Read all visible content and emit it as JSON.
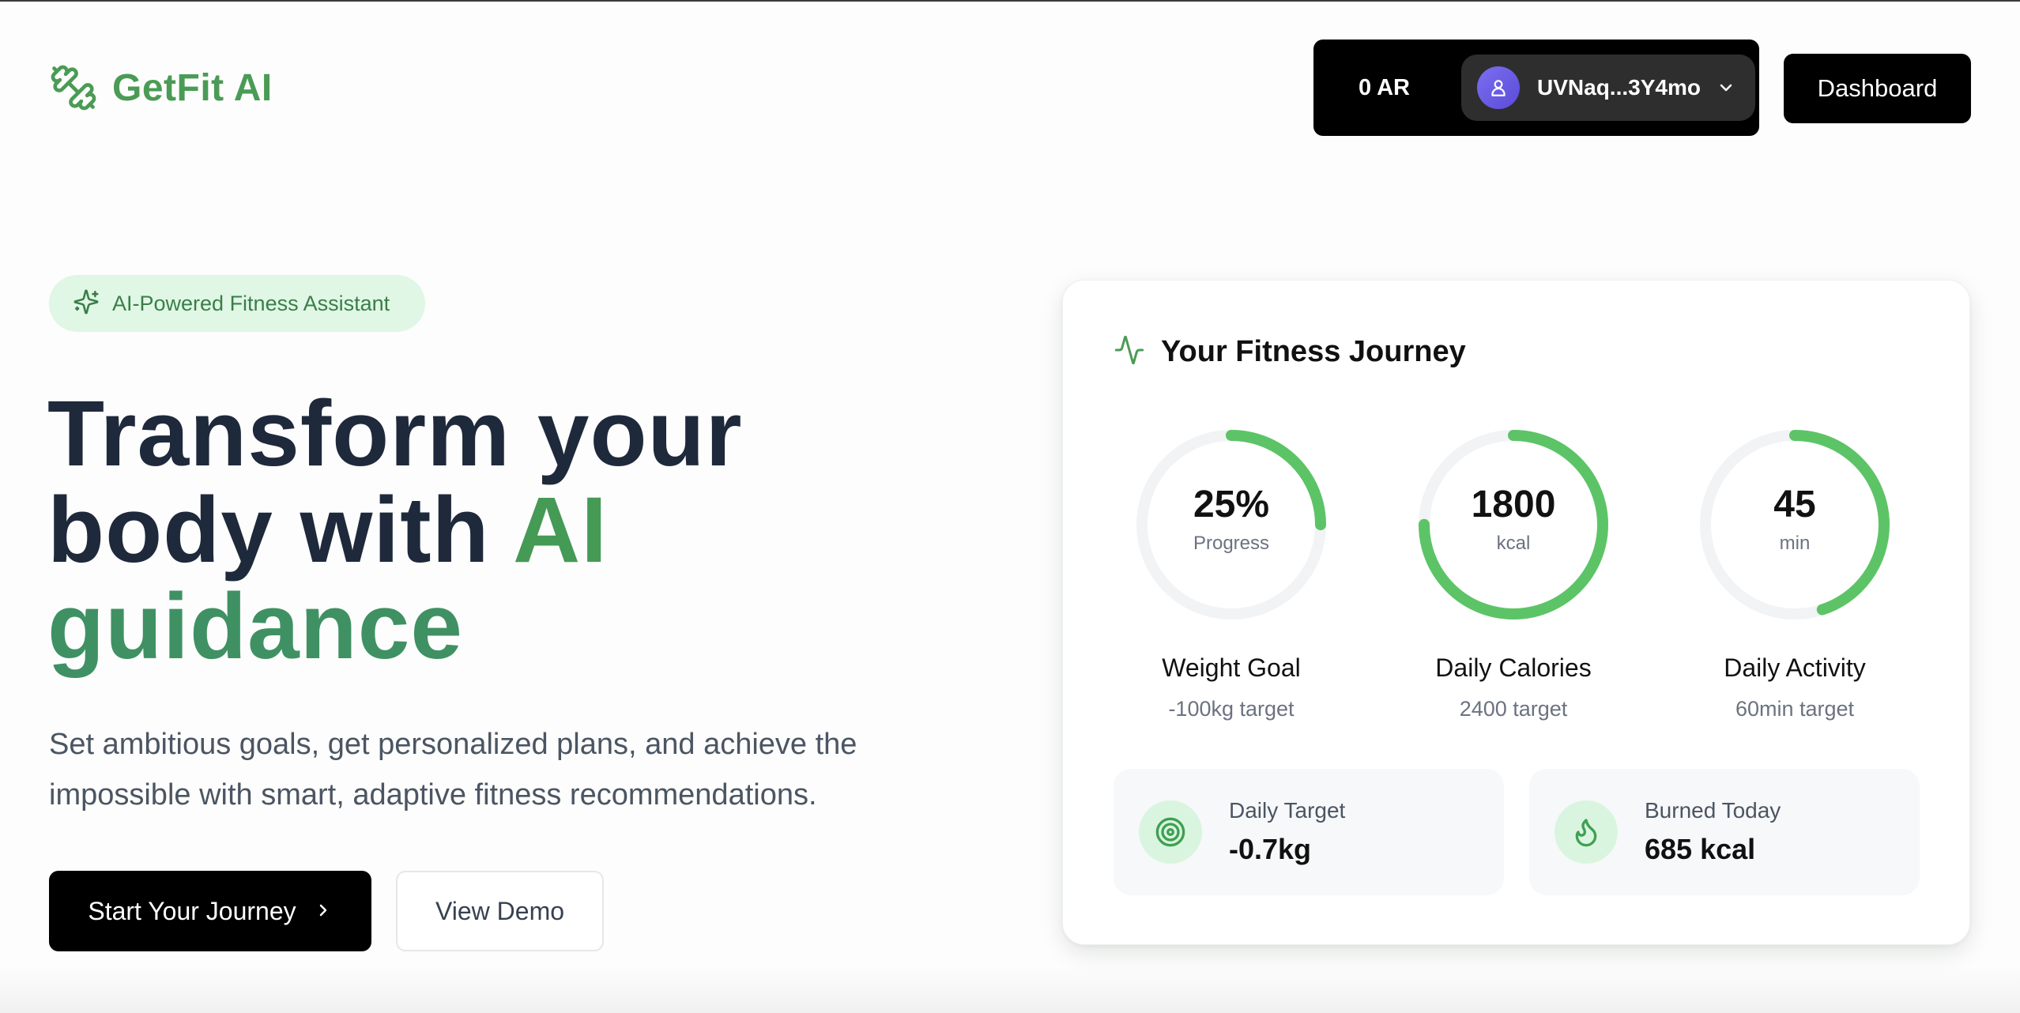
{
  "app": {
    "name": "GetFit AI",
    "brand_color": "#4a9b55",
    "accent_green": "#5cc466"
  },
  "header": {
    "balance": "0 AR",
    "account_address": "UVNaq...3Y4mo",
    "dashboard_label": "Dashboard"
  },
  "hero": {
    "badge": "AI-Powered Fitness Assistant",
    "headline_part1": "Transform your",
    "headline_part2": "body with ",
    "headline_highlight1": "AI",
    "headline_highlight2": "guidance",
    "subtext": "Set ambitious goals, get personalized plans, and achieve the impossible with smart, adaptive fitness recommendations.",
    "primary_cta": "Start Your Journey",
    "secondary_cta": "View Demo"
  },
  "card": {
    "title": "Your Fitness Journey",
    "metrics": [
      {
        "value": "25%",
        "unit": "Progress",
        "title": "Weight Goal",
        "target": "-100kg target",
        "fraction": 0.25
      },
      {
        "value": "1800",
        "unit": "kcal",
        "title": "Daily Calories",
        "target": "2400 target",
        "fraction": 0.75
      },
      {
        "value": "45",
        "unit": "min",
        "title": "Daily Activity",
        "target": "60min target",
        "fraction": 0.45
      }
    ],
    "stats": [
      {
        "label": "Daily Target",
        "value": "-0.7kg",
        "icon": "target-icon"
      },
      {
        "label": "Burned Today",
        "value": "685 kcal",
        "icon": "flame-icon"
      }
    ]
  }
}
